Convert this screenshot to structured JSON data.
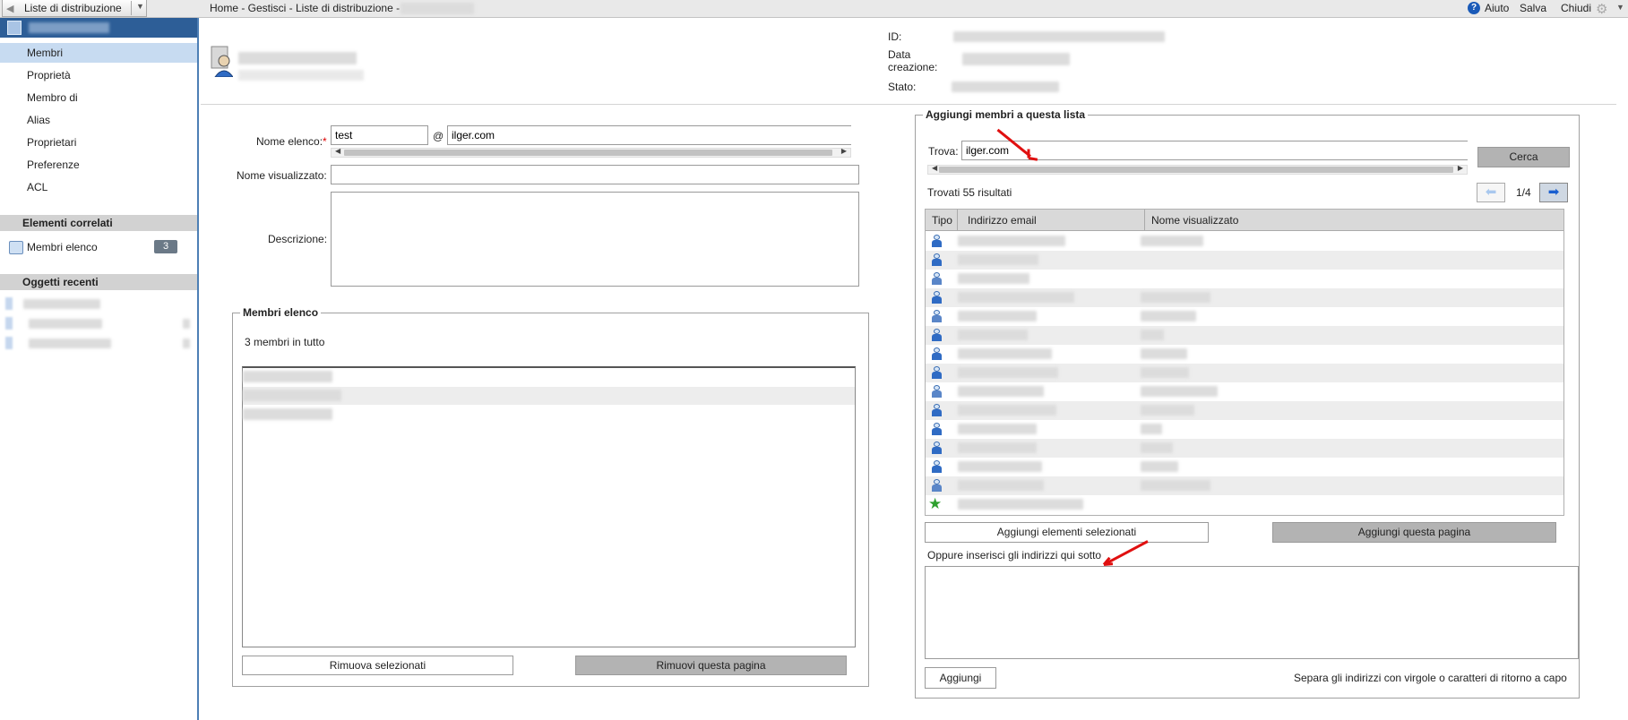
{
  "topbar": {
    "app_button": "Liste di distribuzione",
    "breadcrumb": "Home - Gestisci - Liste di distribuzione -",
    "help": "Aiuto",
    "save": "Salva",
    "close": "Chiudi"
  },
  "sidebar": {
    "items": [
      {
        "label": "Membri",
        "selected": true
      },
      {
        "label": "Proprietà"
      },
      {
        "label": "Membro di"
      },
      {
        "label": "Alias"
      },
      {
        "label": "Proprietari"
      },
      {
        "label": "Preferenze"
      },
      {
        "label": "ACL"
      }
    ],
    "related_title": "Elementi correlati",
    "related_item": "Membri elenco",
    "related_count": "3",
    "recent_title": "Oggetti recenti"
  },
  "header": {
    "id_label": "ID:",
    "created_label_1": "Data",
    "created_label_2": "creazione:",
    "status_label": "Stato:"
  },
  "form": {
    "list_name_label": "Nome elenco:",
    "required_mark": "*",
    "list_name_value": "test",
    "at_sign": "@",
    "domain_value": "ilger.com",
    "display_name_label": "Nome visualizzato:",
    "display_name_value": "",
    "description_label": "Descrizione:",
    "description_value": ""
  },
  "members": {
    "legend": "Membri elenco",
    "count_text": "3 membri in tutto",
    "remove_selected": "Rimuova selezionati",
    "remove_page": "Rimuovi questa pagina"
  },
  "add_members": {
    "legend": "Aggiungi membri a questa lista",
    "find_label": "Trova:",
    "find_value": "ilger.com",
    "search_button": "Cerca",
    "results_text": "Trovati 55 risultati",
    "page_indicator": "1/4",
    "columns": [
      "Tipo",
      "Indirizzo email",
      "Nome visualizzato"
    ],
    "row_types": [
      "user",
      "user",
      "group",
      "user",
      "group",
      "user",
      "user",
      "user",
      "resource",
      "user",
      "user",
      "user",
      "user",
      "group",
      "star"
    ],
    "add_selected": "Aggiungi elementi selezionati",
    "add_page": "Aggiungi questa pagina",
    "or_enter": "Oppure inserisci gli indirizzi qui sotto",
    "addresses_value": "",
    "add_button": "Aggiungi",
    "hint": "Separa gli indirizzi con virgole o caratteri di ritorno a capo"
  },
  "colors": {
    "sidebar_header": "#2d5e97",
    "selected_item": "#c7dbf1",
    "section_header": "#d2d2d2",
    "annotation_arrow": "#e01010"
  }
}
